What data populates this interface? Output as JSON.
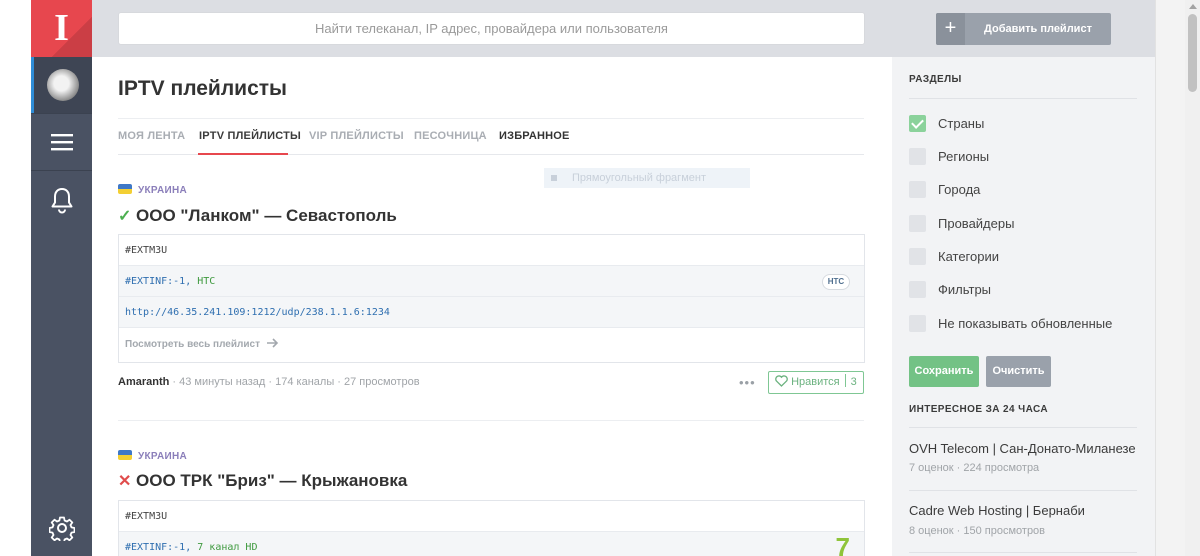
{
  "logo": {
    "letter": "I"
  },
  "search": {
    "placeholder": "Найти телеканал, IP адрес, провайдера или пользователя"
  },
  "page": {
    "title": "IPTV плейлисты"
  },
  "tabs": [
    {
      "label": "МОЯ ЛЕНТА"
    },
    {
      "label": "IPTV ПЛЕЙЛИСТЫ"
    },
    {
      "label": "VIP ПЛЕЙЛИСТЫ"
    },
    {
      "label": "ПЕСОЧНИЦА"
    },
    {
      "label": "ИЗБРАННОЕ"
    }
  ],
  "ghost": {
    "label": "Прямоугольный фрагмент"
  },
  "posts": [
    {
      "country": "УКРАИНА",
      "status": "✓",
      "title": "ООО \"Ланком\" — Севастополь",
      "code_header": "#EXTM3U",
      "extinf_tag": "#EXTINF:-1,",
      "channel": "HTC",
      "channel_logo": "HTC",
      "url": "http://46.35.241.109:1212/udp/238.1.1.6:1234",
      "view_all": "Посмотреть весь плейлист",
      "author": "Amaranth",
      "meta": "· 43 минуты назад · 174 каналы · 27 просмотров",
      "like_label": "Нравится",
      "like_count": "3"
    },
    {
      "country": "УКРАИНА",
      "status": "✕",
      "title": "ООО ТРК \"Бриз\" — Крыжановка",
      "code_header": "#EXTM3U",
      "extinf_tag": "#EXTINF:-1,",
      "channel": "7 канал HD",
      "channel_logo": "7"
    }
  ],
  "sidebar": {
    "add_button": "Добавить плейлист",
    "sections_title": "РАЗДЕЛЫ",
    "filters": [
      {
        "label": "Страны",
        "checked": true
      },
      {
        "label": "Регионы",
        "checked": false
      },
      {
        "label": "Города",
        "checked": false
      },
      {
        "label": "Провайдеры",
        "checked": false
      },
      {
        "label": "Категории",
        "checked": false
      },
      {
        "label": "Фильтры",
        "checked": false
      },
      {
        "label": "Не показывать обновленные",
        "checked": false
      }
    ],
    "save_button": "Сохранить",
    "clear_button": "Очистить",
    "interesting_title": "ИНТЕРЕСНОЕ ЗА 24 ЧАСА",
    "interesting": [
      {
        "title": "OVH Telecom | Сан-Донато-Миланезе",
        "meta": "7 оценок · 224 просмотра"
      },
      {
        "title": "Cadre Web Hosting | Бернаби",
        "meta": "8 оценок · 150 просмотров"
      }
    ]
  },
  "colors": {
    "accent": "#e7474e",
    "nav": "#4a5263",
    "success": "#73c285",
    "flag_blue": "#3f78c7",
    "flag_yellow": "#f3cf33"
  }
}
